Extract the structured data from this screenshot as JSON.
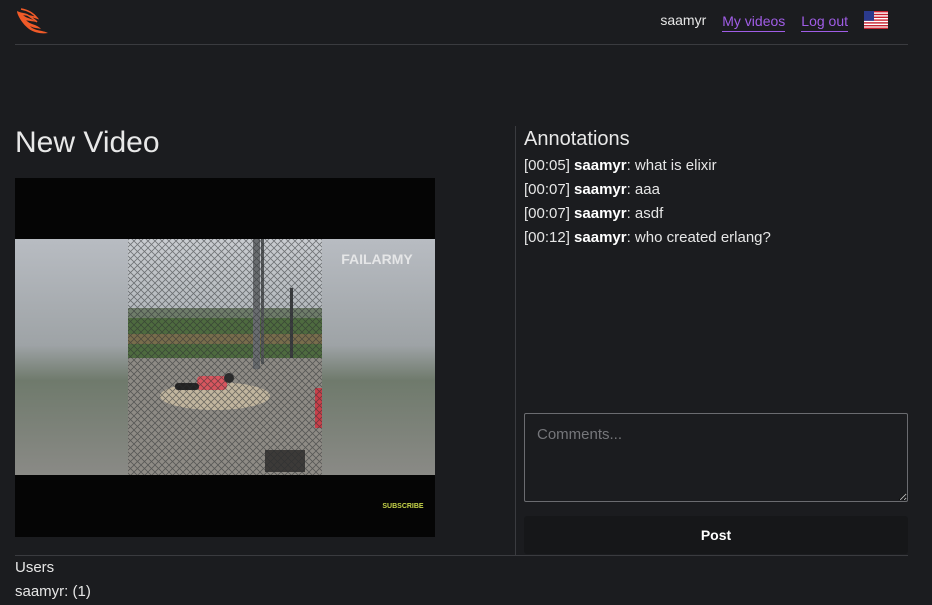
{
  "header": {
    "username": "saamyr",
    "nav": [
      {
        "label": "My videos"
      },
      {
        "label": "Log out"
      }
    ]
  },
  "colors": {
    "accent": "#a05de6",
    "logo": "#f05a28",
    "background": "#1b1c1f"
  },
  "video": {
    "title": "New Video",
    "watermark": "FAILARMY",
    "subscribe_label": "SUBSCRIBE"
  },
  "annotations": {
    "title": "Annotations",
    "items": [
      {
        "time": "[00:05]",
        "user": "saamyr",
        "text": ": what is elixir"
      },
      {
        "time": "[00:07]",
        "user": "saamyr",
        "text": ": aaa"
      },
      {
        "time": "[00:07]",
        "user": "saamyr",
        "text": ": asdf"
      },
      {
        "time": "[00:12]",
        "user": "saamyr",
        "text": ": who created erlang?"
      }
    ],
    "comment_placeholder": "Comments...",
    "post_label": "Post"
  },
  "users": {
    "title": "Users",
    "list": [
      {
        "entry": "saamyr: (1)"
      }
    ]
  }
}
